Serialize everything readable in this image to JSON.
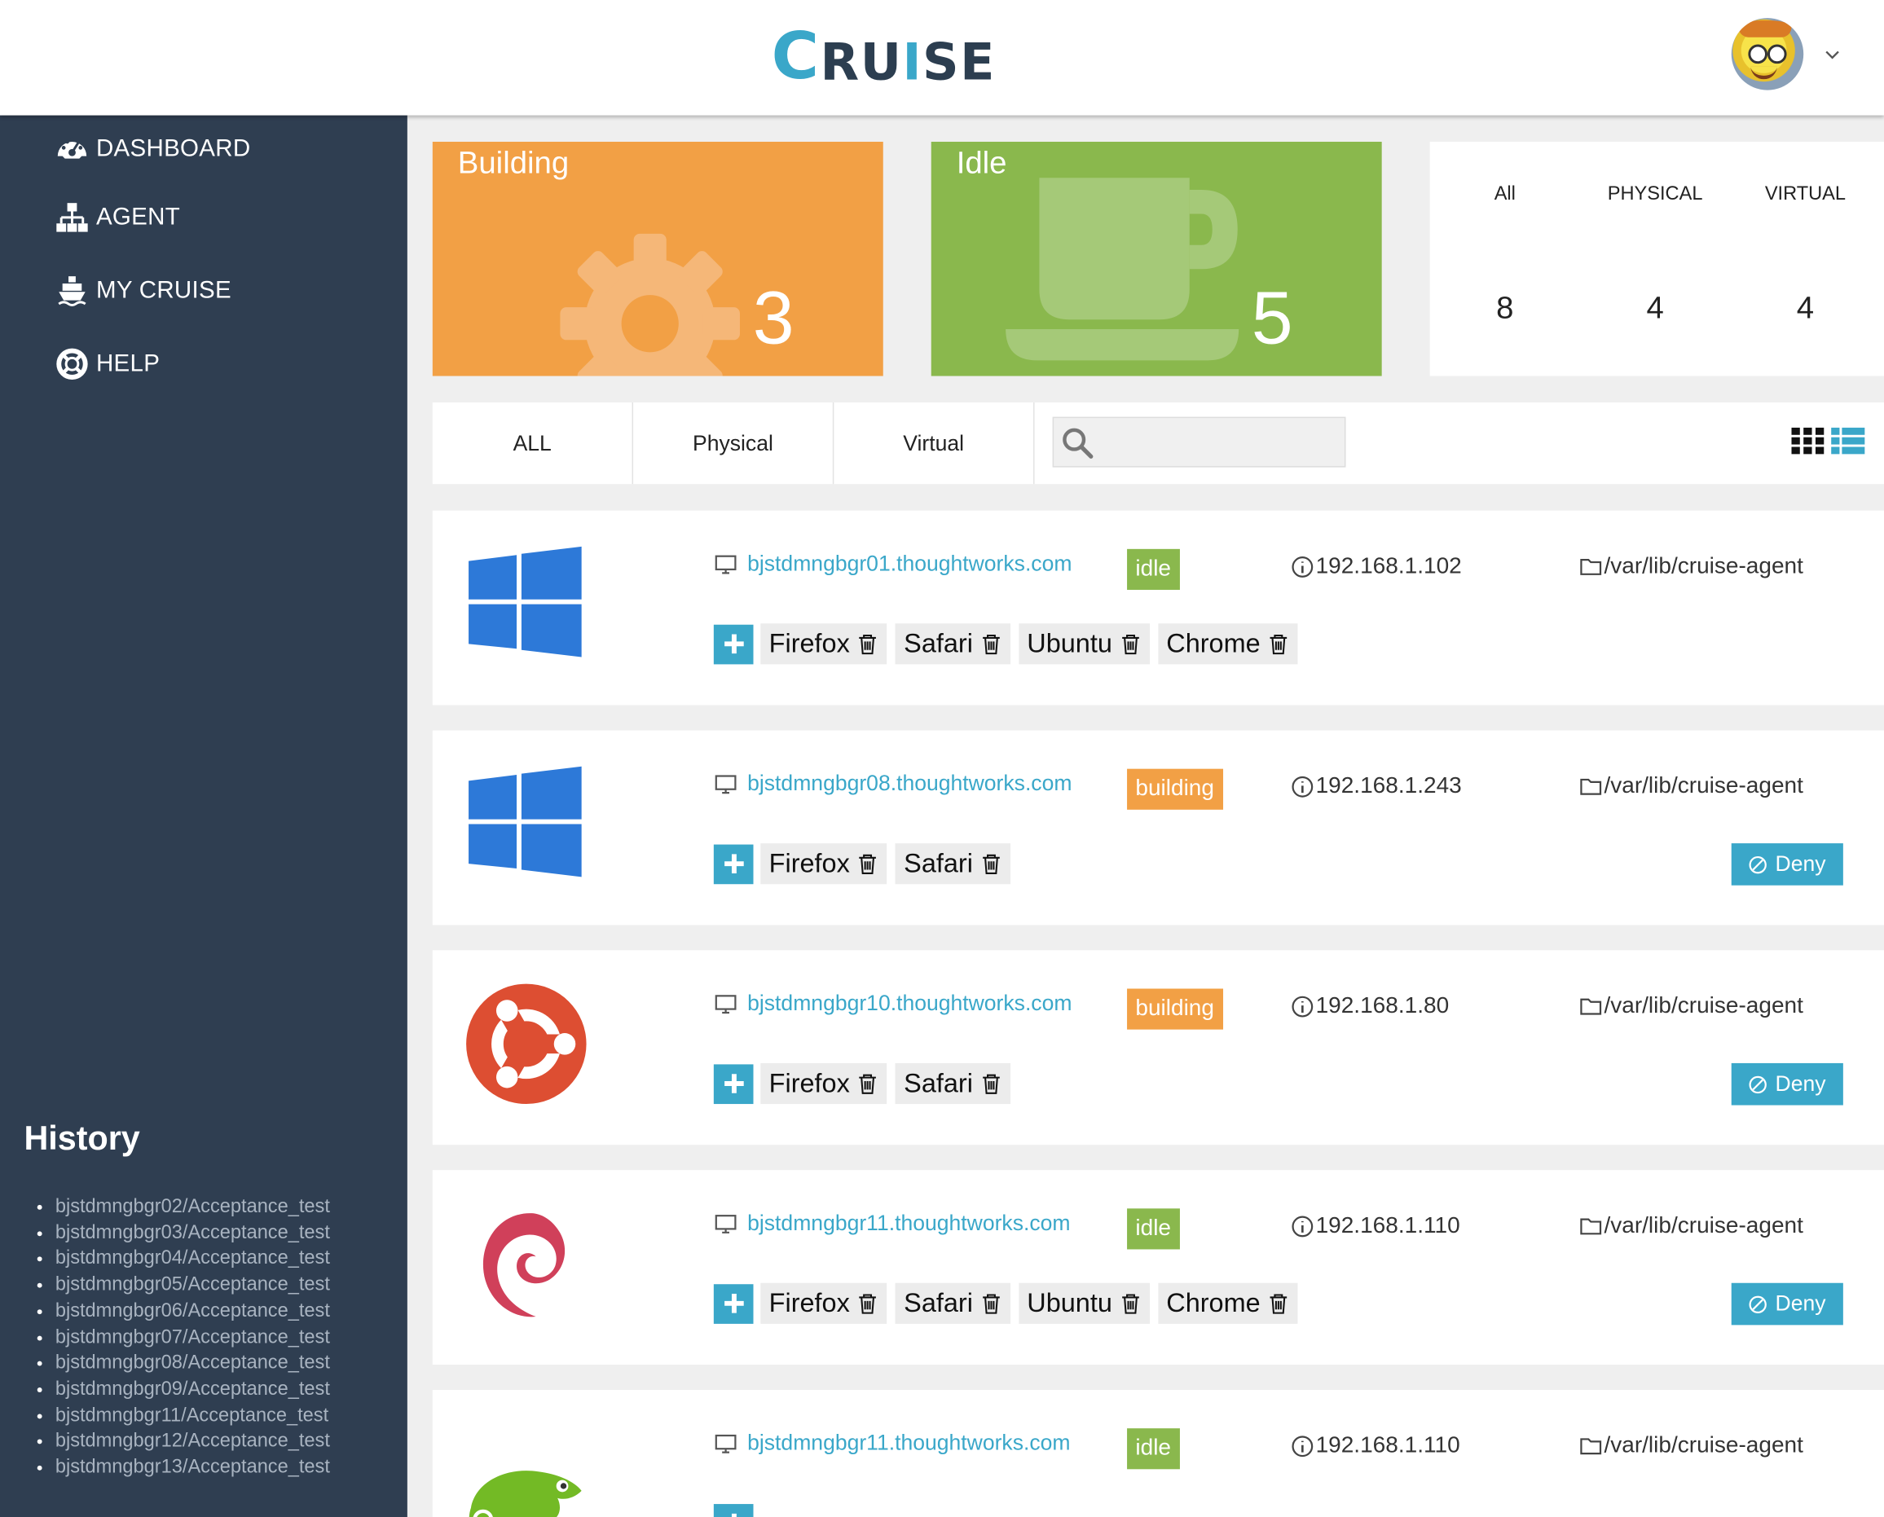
{
  "header": {
    "logo_first": "C",
    "logo_mid": "RU",
    "logo_i": "I",
    "logo_end": "SE"
  },
  "sidebar": {
    "items": [
      {
        "label": "DASHBOARD",
        "icon": "dashboard-icon"
      },
      {
        "label": "AGENT",
        "icon": "sitemap-icon"
      },
      {
        "label": "MY CRUISE",
        "icon": "ship-icon"
      },
      {
        "label": "HELP",
        "icon": "life-ring-icon"
      }
    ],
    "history_title": "History",
    "history": [
      "bjstdmngbgr02/Acceptance_test",
      "bjstdmngbgr03/Acceptance_test",
      "bjstdmngbgr04/Acceptance_test",
      "bjstdmngbgr05/Acceptance_test",
      "bjstdmngbgr06/Acceptance_test",
      "bjstdmngbgr07/Acceptance_test",
      "bjstdmngbgr08/Acceptance_test",
      "bjstdmngbgr09/Acceptance_test",
      "bjstdmngbgr11/Acceptance_test",
      "bjstdmngbgr12/Acceptance_test",
      "bjstdmngbgr13/Acceptance_test"
    ]
  },
  "summary": {
    "building": {
      "label": "Building",
      "count": "3",
      "color": "#f2a045"
    },
    "idle": {
      "label": "Idle",
      "count": "5",
      "color": "#8ab84d"
    },
    "counts": {
      "all_label": "All",
      "all_value": "8",
      "physical_label": "PHYSICAL",
      "physical_value": "4",
      "virtual_label": "VIRTUAL",
      "virtual_value": "4"
    }
  },
  "filters": {
    "tabs": [
      "ALL",
      "Physical",
      "Virtual"
    ],
    "search_placeholder": ""
  },
  "colors": {
    "accent": "#3aa7c9",
    "sidebar": "#2f3e51",
    "idle": "#8ab84d",
    "building": "#f2a045"
  },
  "agents": [
    {
      "os": "windows",
      "host": "bjstdmngbgr01.thoughtworks.com",
      "status": "idle",
      "ip": "192.168.1.102",
      "path": "/var/lib/cruise-agent",
      "resources": [
        "Firefox",
        "Safari",
        "Ubuntu",
        "Chrome"
      ],
      "deny": ""
    },
    {
      "os": "windows",
      "host": "bjstdmngbgr08.thoughtworks.com",
      "status": "building",
      "ip": "192.168.1.243",
      "path": "/var/lib/cruise-agent",
      "resources": [
        "Firefox",
        "Safari"
      ],
      "deny": "Deny"
    },
    {
      "os": "ubuntu",
      "host": "bjstdmngbgr10.thoughtworks.com",
      "status": "building",
      "ip": "192.168.1.80",
      "path": "/var/lib/cruise-agent",
      "resources": [
        "Firefox",
        "Safari"
      ],
      "deny": "Deny"
    },
    {
      "os": "debian",
      "host": "bjstdmngbgr11.thoughtworks.com",
      "status": "idle",
      "ip": "192.168.1.110",
      "path": "/var/lib/cruise-agent",
      "resources": [
        "Firefox",
        "Safari",
        "Ubuntu",
        "Chrome"
      ],
      "deny": "Deny"
    },
    {
      "os": "suse",
      "host": "bjstdmngbgr11.thoughtworks.com",
      "status": "idle",
      "ip": "192.168.1.110",
      "path": "/var/lib/cruise-agent",
      "resources": [],
      "deny": ""
    }
  ]
}
